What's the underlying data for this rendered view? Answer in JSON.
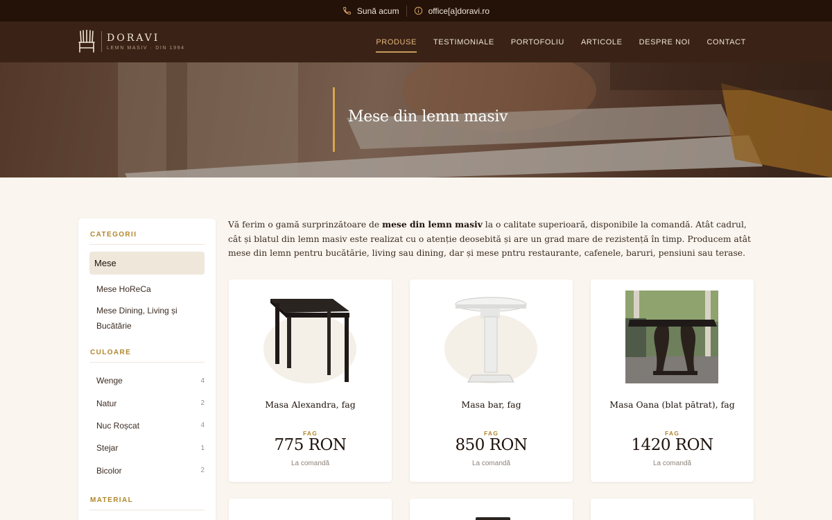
{
  "topbar": {
    "phone_label": "Sună acum",
    "email_label": "office[a]doravi.ro"
  },
  "brand": {
    "name": "DORAVI",
    "tagline": "LEMN MASIV · DIN 1994"
  },
  "nav": [
    {
      "label": "PRODUSE",
      "active": true
    },
    {
      "label": "TESTIMONIALE"
    },
    {
      "label": "PORTOFOLIU"
    },
    {
      "label": "ARTICOLE"
    },
    {
      "label": "DESPRE NOI"
    },
    {
      "label": "CONTACT"
    }
  ],
  "hero": {
    "title": "Mese din lemn masiv"
  },
  "sidebar": {
    "categories_title": "CATEGORII",
    "categories": [
      "Mese",
      "Mese HoReCa",
      "Mese Dining, Living și Bucătărie"
    ],
    "colors_title": "CULOARE",
    "colors": [
      {
        "label": "Wenge",
        "count": "4"
      },
      {
        "label": "Natur",
        "count": "2"
      },
      {
        "label": "Nuc Roșcat",
        "count": "4"
      },
      {
        "label": "Stejar",
        "count": "1"
      },
      {
        "label": "Bicolor",
        "count": "2"
      }
    ],
    "material_title": "MATERIAL"
  },
  "intro": {
    "part1": "Vă ferim o gamă surprinzătoare de ",
    "bold": "mese din lemn masiv",
    "part2": " la o calitate superioară, disponibile la comandă. Atât cadrul, cât și blatul din lemn masiv este realizat cu o atenție deosebită și are un grad mare de rezistență în timp. Producem atât mese din lemn pentru bucătărie, living sau dining, dar și mese pntru restaurante, cafenele, baruri, pensiuni sau terase."
  },
  "products": [
    {
      "name": "Masa Alexandra, fag",
      "wood": "FAG",
      "price": "775 RON",
      "availability": "La comandă",
      "image": "dark-square-table"
    },
    {
      "name": "Masa bar, fag",
      "wood": "FAG",
      "price": "850 RON",
      "availability": "La comandă",
      "image": "white-bar-table"
    },
    {
      "name": "Masa Oana (blat pătrat), fag",
      "wood": "FAG",
      "price": "1420 RON",
      "availability": "La comandă",
      "image": "terrace-table-photo"
    }
  ],
  "colors": {
    "topbar_bg": "#241209",
    "header_bg": "#3a2216",
    "accent": "#c79a5c",
    "gold_label": "#b0862c",
    "page_bg": "#faf6ef"
  }
}
